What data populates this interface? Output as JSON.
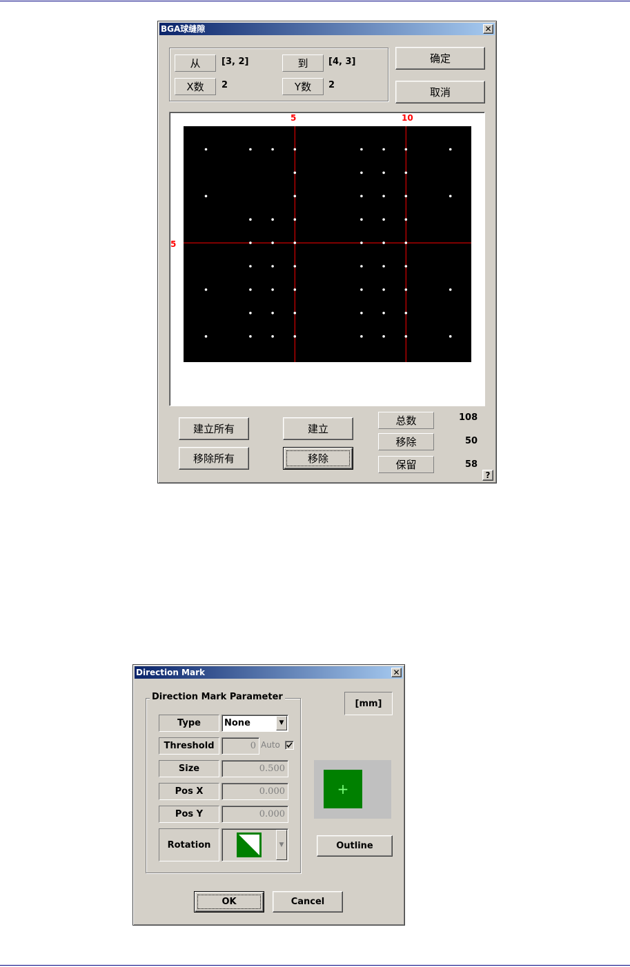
{
  "bga_dialog": {
    "title": "BGA球缝隙",
    "close_glyph": "✕",
    "from_label": "从",
    "from_value": "[3, 2]",
    "to_label": "到",
    "to_value": "[4, 3]",
    "x_count_label": "X数",
    "x_count_value": "2",
    "y_count_label": "Y数",
    "y_count_value": "2",
    "ok_label": "确定",
    "cancel_label": "取消",
    "axis_col_label_1": "5",
    "axis_col_label_2": "10",
    "axis_row_label_1": "5",
    "build_all_label": "建立所有",
    "remove_all_label": "移除所有",
    "build_label": "建立",
    "remove_label": "移除",
    "total_label": "总数",
    "total_value": "108",
    "removed_label": "移除",
    "removed_value": "50",
    "kept_label": "保留",
    "kept_value": "58",
    "help_glyph": "?",
    "grid": {
      "columns": 12,
      "rows": 9,
      "present_columns_all_rows": [
        1,
        4,
        5,
        6,
        7,
        8,
        11
      ],
      "present_columns_inner_rows": [
        2,
        3
      ],
      "inner_rows": [
        4,
        5,
        6,
        8
      ],
      "cursor_col": 5,
      "cursor_row": 5,
      "cursor_col_2": 10,
      "colors": {
        "background": "#000000",
        "ball": "#ffffff",
        "cursor": "#ff0000"
      }
    }
  },
  "direction_dialog": {
    "title": "Direction Mark",
    "close_glyph": "✕",
    "group_title": "Direction Mark Parameter",
    "unit_label": "[mm]",
    "type_label": "Type",
    "type_value": "None",
    "threshold_label": "Threshold",
    "threshold_value": "0",
    "auto_label": "Auto",
    "size_label": "Size",
    "size_value": "0.500",
    "posx_label": "Pos X",
    "posx_value": "0.000",
    "posy_label": "Pos Y",
    "posy_value": "0.000",
    "rotation_label": "Rotation",
    "outline_label": "Outline",
    "ok_label": "OK",
    "cancel_label": "Cancel",
    "preview_glyph": "+",
    "colors": {
      "mark_green": "#008000",
      "preview_bg": "#c0c0c0"
    }
  }
}
